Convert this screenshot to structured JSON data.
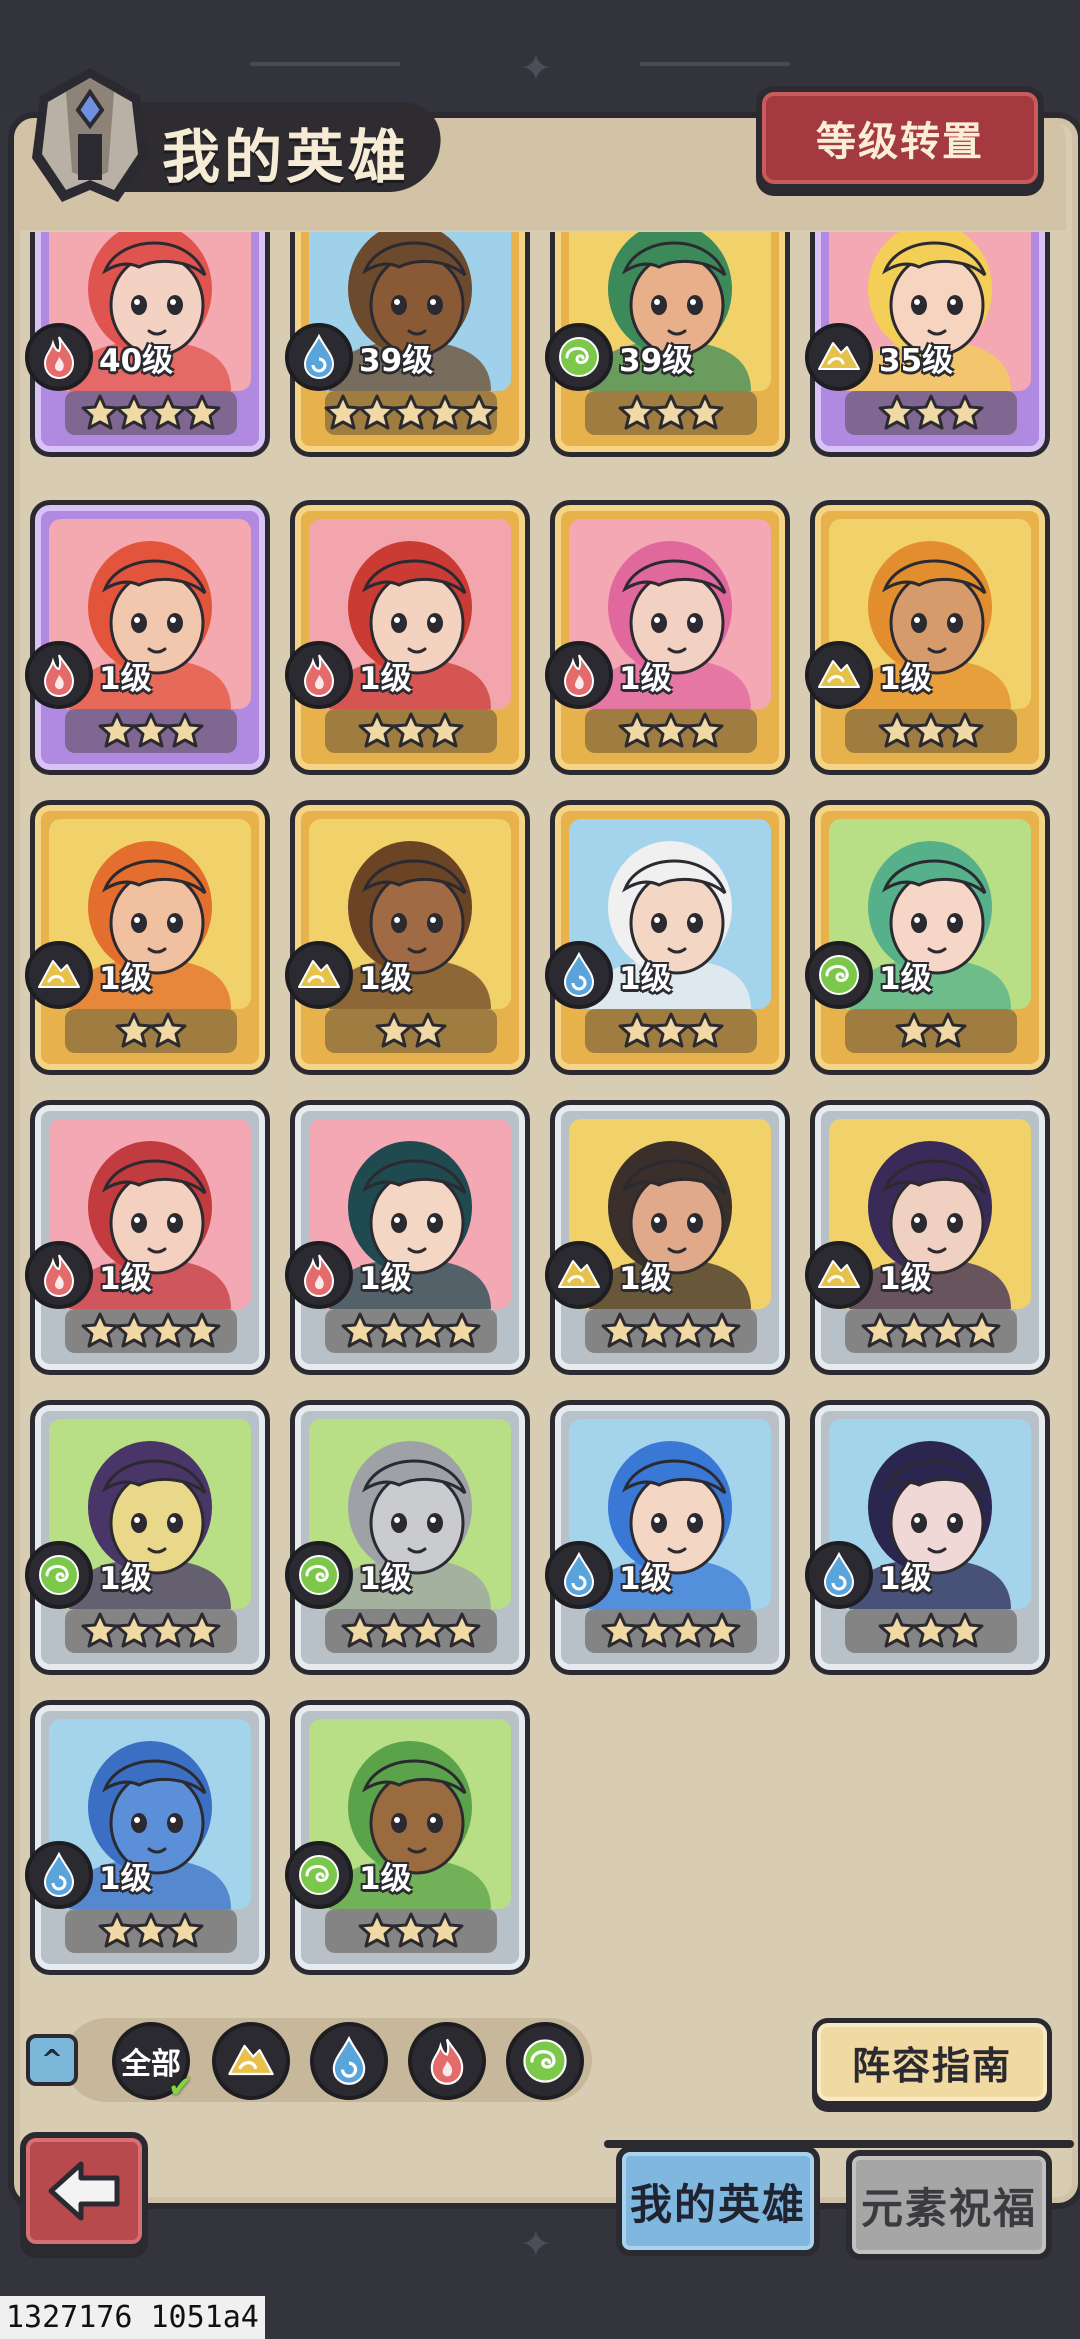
{
  "header": {
    "title": "我的英雄",
    "level_transfer_label": "等级转置"
  },
  "colors": {
    "fire": "#e46b6b",
    "water": "#5aa4dc",
    "wind": "#7cc84a",
    "earth": "#e6c24a"
  },
  "heroes": [
    {
      "level": "40级",
      "element": "fire",
      "stars": 4,
      "rarity": "purple",
      "skin": "#f3d2c4",
      "hair": "#e0544f",
      "bg": "#f4a8b0"
    },
    {
      "level": "39级",
      "element": "water",
      "stars": 5,
      "rarity": "gold",
      "skin": "#8a5a36",
      "hair": "#6b4a2e",
      "bg": "#9fd2ea"
    },
    {
      "level": "39级",
      "element": "wind",
      "stars": 3,
      "rarity": "gold",
      "skin": "#e7b08a",
      "hair": "#3c8a5a",
      "bg": "#f1d26a"
    },
    {
      "level": "35级",
      "element": "earth",
      "stars": 3,
      "rarity": "purple",
      "skin": "#f6d4bf",
      "hair": "#f3cf57",
      "bg": "#f3a8b3"
    },
    {
      "level": "1级",
      "element": "fire",
      "stars": 3,
      "rarity": "purple",
      "skin": "#f1c8ae",
      "hair": "#e3543d",
      "bg": "#f4a8b0"
    },
    {
      "level": "1级",
      "element": "fire",
      "stars": 3,
      "rarity": "gold",
      "skin": "#f3d2c0",
      "hair": "#c93b33",
      "bg": "#f3a5ad"
    },
    {
      "level": "1级",
      "element": "fire",
      "stars": 3,
      "rarity": "gold",
      "skin": "#f2d0c2",
      "hair": "#e0689c",
      "bg": "#f3a8b3"
    },
    {
      "level": "1级",
      "element": "earth",
      "stars": 3,
      "rarity": "gold",
      "skin": "#d79a6b",
      "hair": "#e38e2e",
      "bg": "#f1d26a"
    },
    {
      "level": "1级",
      "element": "earth",
      "stars": 2,
      "rarity": "gold",
      "skin": "#f1c0a0",
      "hair": "#e36e2d",
      "bg": "#f1d26a"
    },
    {
      "level": "1级",
      "element": "earth",
      "stars": 2,
      "rarity": "gold",
      "skin": "#a06a44",
      "hair": "#6b4426",
      "bg": "#f1d26a"
    },
    {
      "level": "1级",
      "element": "water",
      "stars": 3,
      "rarity": "gold",
      "skin": "#f3d6c4",
      "hair": "#f0f0f0",
      "bg": "#a3d4ec"
    },
    {
      "level": "1级",
      "element": "wind",
      "stars": 2,
      "rarity": "gold",
      "skin": "#f6d6c6",
      "hair": "#56b08a",
      "bg": "#b9df86"
    },
    {
      "level": "1级",
      "element": "fire",
      "stars": 4,
      "rarity": "silver",
      "skin": "#f3d0bf",
      "hair": "#c23b3f",
      "bg": "#f3a8b3"
    },
    {
      "level": "1级",
      "element": "fire",
      "stars": 4,
      "rarity": "silver",
      "skin": "#f3d6c4",
      "hair": "#1f4a4f",
      "bg": "#f3a8b3"
    },
    {
      "level": "1级",
      "element": "earth",
      "stars": 4,
      "rarity": "silver",
      "skin": "#e0a98a",
      "hair": "#3a2f2a",
      "bg": "#f1d26a"
    },
    {
      "level": "1级",
      "element": "earth",
      "stars": 4,
      "rarity": "silver",
      "skin": "#f0d0c0",
      "hair": "#3a2a58",
      "bg": "#f1d26a"
    },
    {
      "level": "1级",
      "element": "wind",
      "stars": 4,
      "rarity": "silver",
      "skin": "#e9d88a",
      "hair": "#4a3568",
      "bg": "#b9df86"
    },
    {
      "level": "1级",
      "element": "wind",
      "stars": 4,
      "rarity": "silver",
      "skin": "#c9cbcf",
      "hair": "#9ea2a7",
      "bg": "#b9df86"
    },
    {
      "level": "1级",
      "element": "water",
      "stars": 4,
      "rarity": "silver",
      "skin": "#f3d6c4",
      "hair": "#3a78d6",
      "bg": "#a3d4ec"
    },
    {
      "level": "1级",
      "element": "water",
      "stars": 3,
      "rarity": "silver",
      "skin": "#f0d8d6",
      "hair": "#2a2650",
      "bg": "#a3d4ec"
    },
    {
      "level": "1级",
      "element": "water",
      "stars": 3,
      "rarity": "silver",
      "skin": "#5b8fd8",
      "hair": "#3b6fc4",
      "bg": "#a3d4ec"
    },
    {
      "level": "1级",
      "element": "wind",
      "stars": 3,
      "rarity": "silver",
      "skin": "#9a6b3e",
      "hair": "#5aa34a",
      "bg": "#b9df86"
    }
  ],
  "filters": {
    "all_label": "全部",
    "elements": [
      "earth",
      "water",
      "fire",
      "wind"
    ]
  },
  "guide_label": "阵容指南",
  "tabs": [
    {
      "label": "我的英雄",
      "active": true
    },
    {
      "label": "元素祝福",
      "active": false
    }
  ],
  "debug_text": "1327176 1051a4"
}
